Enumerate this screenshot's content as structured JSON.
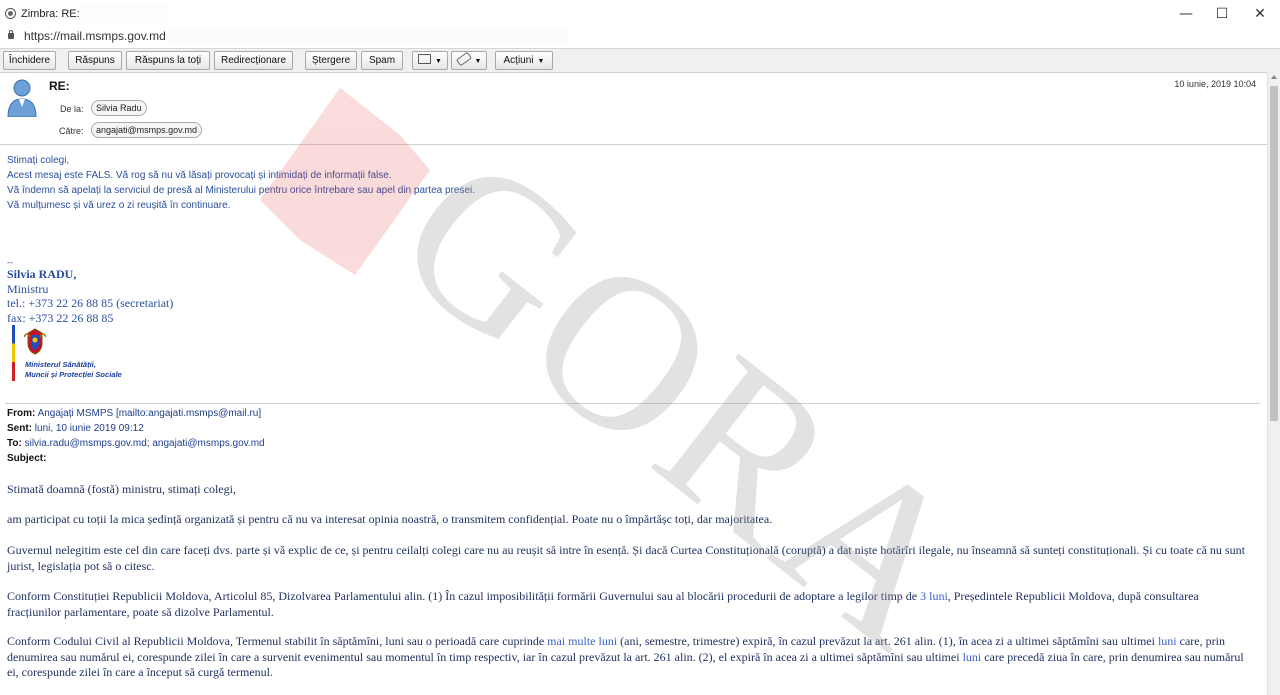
{
  "window": {
    "title": "Zimbra: RE: -",
    "minimize": "—",
    "maximize": "☐",
    "close": "✕"
  },
  "address_bar": {
    "url": "https://mail.msmps.gov.md"
  },
  "toolbar": {
    "close": "Închidere",
    "reply": "Răspuns",
    "reply_all": "Răspuns la toți",
    "forward": "Redirecționare",
    "delete": "Ștergere",
    "spam": "Spam",
    "actions": "Acțiuni"
  },
  "header": {
    "subject": "RE:",
    "date": "10 iunie, 2019 10:04",
    "from_label": "De la:",
    "from": "Silvia Radu",
    "to_label": "Către:",
    "to": "angajati@msmps.gov.md"
  },
  "reply": {
    "lines": [
      "Stimați colegi,",
      "Acest mesaj este FALS. Vă rog să nu vă lăsați provocați și intimidați de informații false.",
      "Vă îndemn să apelați la serviciul de presă al Ministerului pentru orice întrebare sau apel din partea presei.",
      "Vă mulțumesc și vă urez o zi reușită în continuare."
    ]
  },
  "signature": {
    "dashes": "--",
    "name": "Silvia RADU,",
    "role": "Ministru",
    "tel": "tel.: +373 22 26 88 85 (secretariat)",
    "fax": "fax: +373 22 26 88 85",
    "logo_line1": "Ministerul Sănătății,",
    "logo_line2": "Muncii și Protecției Sociale"
  },
  "original": {
    "from_label": "From:",
    "from": "Angajați MSMPS [mailto:angajati.msmps@mail.ru]",
    "sent_label": "Sent:",
    "sent": "luni, 10 iunie 2019 09:12",
    "to_label": "To:",
    "to": "silvia.radu@msmps.gov.md; angajati@msmps.gov.md",
    "subject_label": "Subject:",
    "p1": "Stimată doamnă (fostă) ministru, stimați colegi,",
    "p2": "am participat cu toții la mica ședință organizată și pentru că nu va interesat opinia noastră, o transmitem confidențial. Poate nu o împărtășc toți, dar majoritatea.",
    "p3": "Guvernul nelegitim este cel din care faceți dvs. parte și vă explic de ce, și pentru ceilalți colegi care nu au reușit să intre în esență. Și dacă Curtea Constituțională (coruptă) a dat niște hotărîri ilegale, nu înseamnă să sunteți constituționali. Și cu toate că nu sunt jurist, legislația pot să o citesc.",
    "p4a": "Conform Constituției Republicii Moldova, Articolul 85, Dizolvarea Parlamentului alin. (1) În cazul imposibilității formării Guvernului sau al blocării procedurii de adoptare a legilor timp de ",
    "p4b": "3 luni",
    "p4c": ", Președintele Republicii Moldova, după consultarea fracțiunilor parlamentare, poate să dizolve Parlamentul.",
    "p5a": "Conform Codului Civil al Republicii Moldova, Termenul stabilit în săptămîni, luni sau o perioadă care cuprinde ",
    "p5b": "mai multe luni",
    "p5c": " (ani, semestre, trimestre) expiră, în cazul prevăzut la art. 261 alin. (1), în acea zi a ultimei săptămîni sau ultimei ",
    "p5d": "luni",
    "p5e": " care, prin denumirea sau numărul ei, corespunde zilei în care a survenit evenimentul sau momentul în timp respectiv, iar în cazul prevăzut la art. 261 alin. (2), el expiră în acea zi a ultimei săptămîni sau ultimei ",
    "p5f": "luni",
    "p5g": " care precedă ziua în care, prin denumirea sau numărul ei, corespunde zilei în care a început să curgă termenul."
  },
  "watermark": {
    "text": "GORA"
  },
  "colors": {
    "link_blue": "#2a4f9e",
    "watermark_red": "#e63b3b",
    "toolbar_bg": "#f0f0f0"
  }
}
